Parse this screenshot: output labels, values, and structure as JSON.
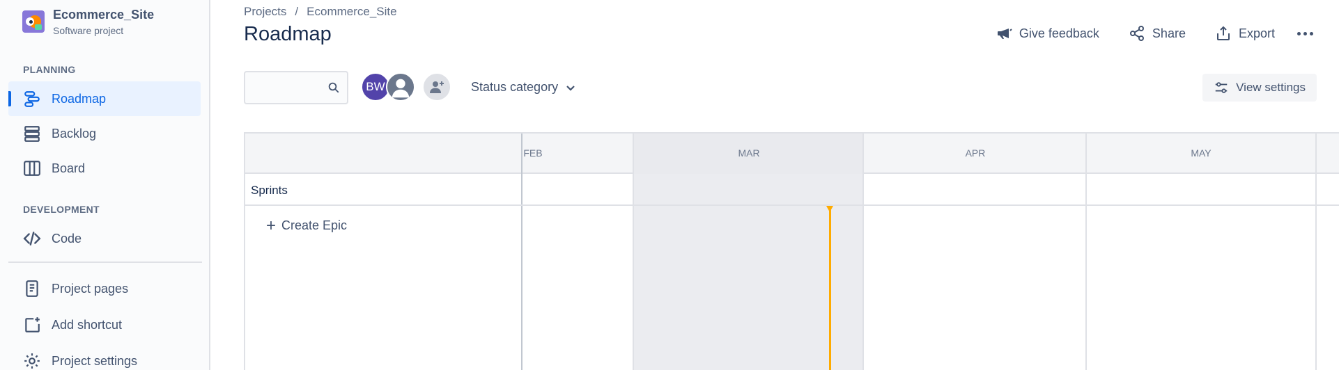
{
  "project": {
    "name": "Ecommerce_Site",
    "type": "Software project"
  },
  "sidebar": {
    "planning_label": "PLANNING",
    "development_label": "DEVELOPMENT",
    "items": [
      {
        "label": "Roadmap",
        "icon": "roadmap-icon",
        "active": true
      },
      {
        "label": "Backlog",
        "icon": "backlog-icon",
        "active": false
      },
      {
        "label": "Board",
        "icon": "board-icon",
        "active": false
      },
      {
        "label": "Code",
        "icon": "code-icon",
        "active": false
      },
      {
        "label": "Project pages",
        "icon": "page-icon",
        "active": false
      },
      {
        "label": "Add shortcut",
        "icon": "add-shortcut-icon",
        "active": false
      },
      {
        "label": "Project settings",
        "icon": "gear-icon",
        "active": false
      }
    ]
  },
  "breadcrumb": {
    "items": [
      "Projects",
      "Ecommerce_Site"
    ],
    "separator": "/"
  },
  "page": {
    "title": "Roadmap"
  },
  "actions": {
    "feedback": "Give feedback",
    "share": "Share",
    "export": "Export"
  },
  "filters": {
    "search_placeholder": "",
    "avatar_initials": "BW",
    "status_category": "Status category",
    "view_settings": "View settings"
  },
  "timeline": {
    "months": [
      "FEB",
      "MAR",
      "APR",
      "MAY"
    ],
    "sprints_label": "Sprints",
    "create_epic": "Create Epic"
  },
  "colors": {
    "accent": "#0c66e4",
    "today_marker": "#ffab00",
    "avatar_bw": "#5243aa"
  }
}
